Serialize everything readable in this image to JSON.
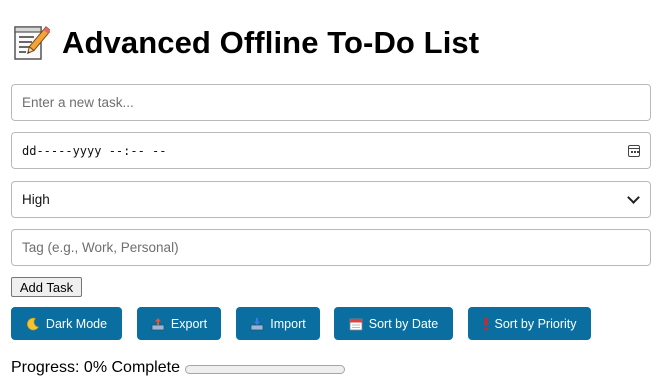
{
  "header": {
    "title": "Advanced Offline To-Do List",
    "icon": "memo-icon"
  },
  "form": {
    "task_placeholder": "Enter a new task...",
    "date_placeholder": "dd-----yyyy --:-- --",
    "priority_selected": "High",
    "tag_placeholder": "Tag (e.g., Work, Personal)",
    "add_label": "Add Task"
  },
  "actions": [
    {
      "label": "Dark Mode",
      "icon": "crescent-moon-icon"
    },
    {
      "label": "Export",
      "icon": "outbox-tray-icon"
    },
    {
      "label": "Import",
      "icon": "inbox-tray-icon"
    },
    {
      "label": "Sort by Date",
      "icon": "calendar-icon"
    },
    {
      "label": "Sort by Priority",
      "icon": "exclamation-icon"
    }
  ],
  "progress": {
    "label": "Progress: 0% Complete",
    "value": 0
  },
  "colors": {
    "accent": "#0a6ea0",
    "border": "#b9b9b9",
    "bar_track": "#efefef"
  }
}
